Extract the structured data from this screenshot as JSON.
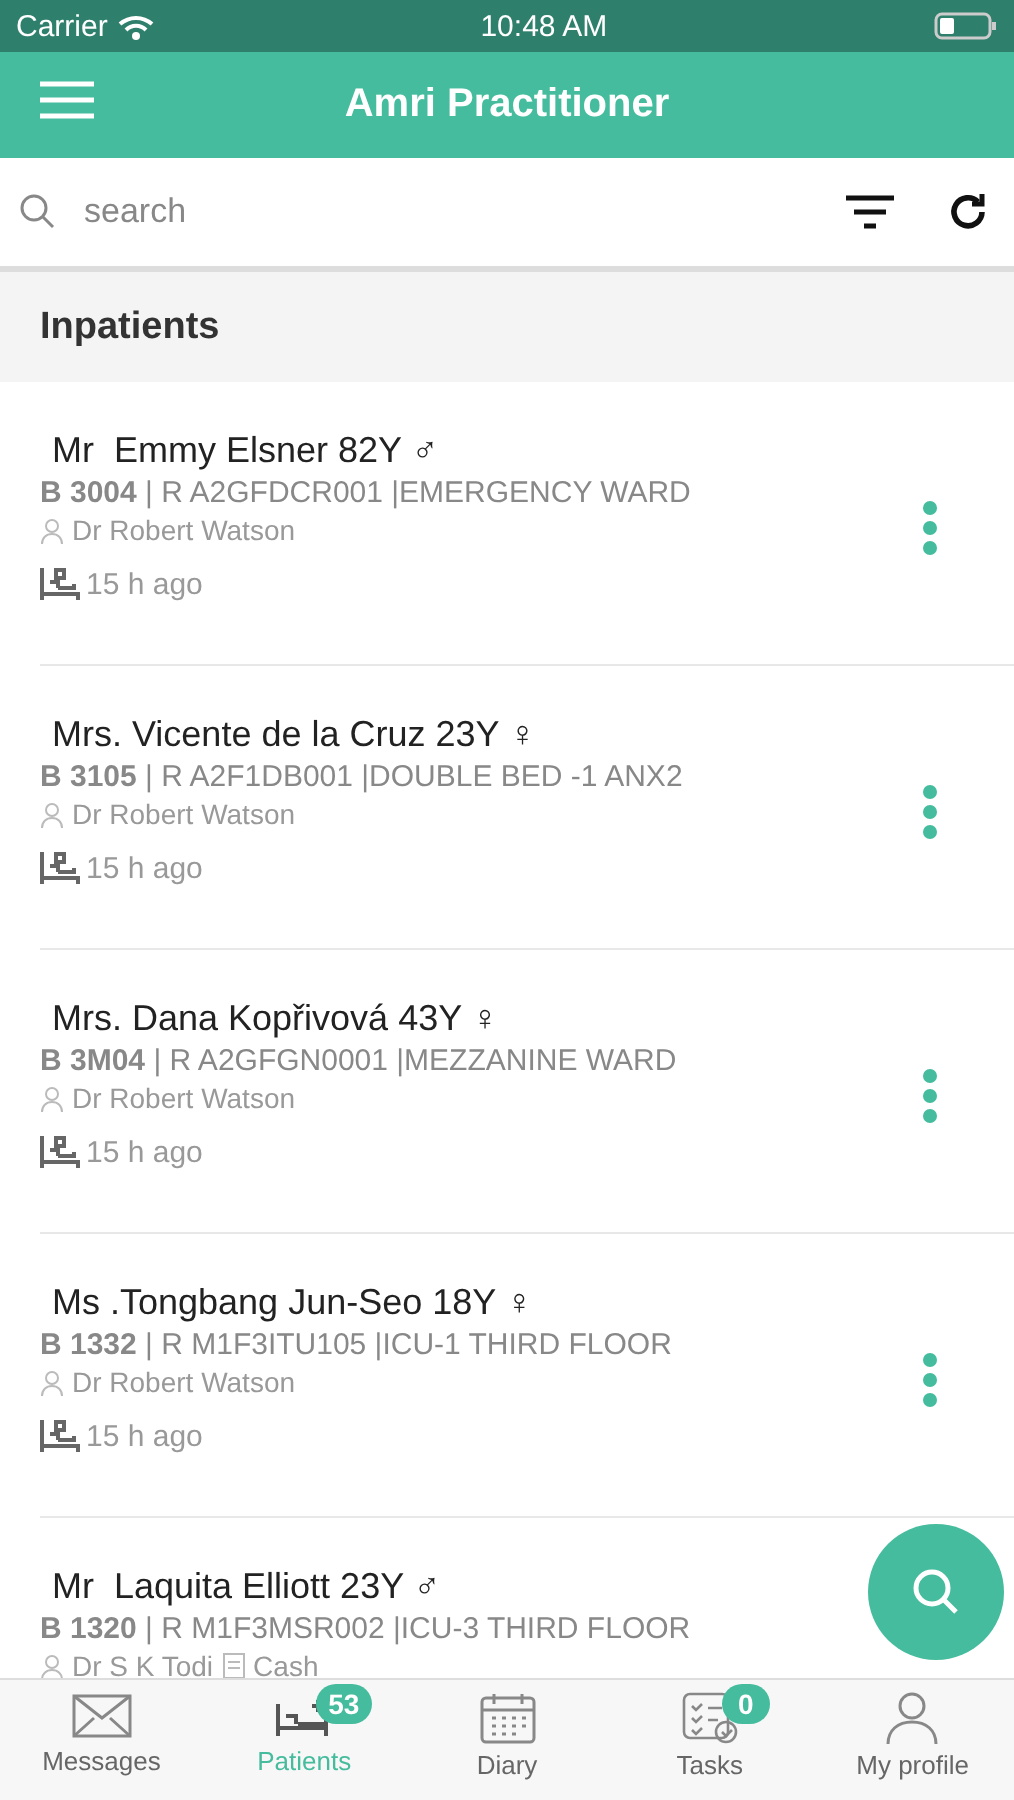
{
  "status_bar": {
    "carrier": "Carrier",
    "time": "10:48 AM"
  },
  "header": {
    "title": "Amri Practitioner"
  },
  "search": {
    "placeholder": "search"
  },
  "section": {
    "title": "Inpatients"
  },
  "patients": [
    {
      "name": "Mr  Emmy Elsner 82Y ♂",
      "bed": "B 3004",
      "room": " | R A2GFDCR001 |EMERGENCY WARD",
      "doctor": "Dr Robert Watson",
      "time": "15 h ago"
    },
    {
      "name": "Mrs. Vicente de la Cruz 23Y ♀",
      "bed": "B 3105",
      "room": " | R A2F1DB001 |DOUBLE BED -1 ANX2",
      "doctor": "Dr Robert Watson",
      "time": "15 h ago"
    },
    {
      "name": "Mrs. Dana Kopřivová 43Y ♀",
      "bed": "B 3M04",
      "room": " | R A2GFGN0001 |MEZZANINE WARD",
      "doctor": "Dr Robert Watson",
      "time": "15 h ago"
    },
    {
      "name": "Ms .Tongbang Jun-Seo 18Y ♀",
      "bed": "B 1332",
      "room": " | R M1F3ITU105 |ICU-1 THIRD FLOOR",
      "doctor": "Dr Robert Watson",
      "time": "15 h ago"
    },
    {
      "name": "Mr  Laquita Elliott 23Y ♂",
      "bed": "B 1320",
      "room": " | R M1F3MSR002 |ICU-3 THIRD FLOOR",
      "doctor": "Dr S K  Todi",
      "payment": "Cash"
    }
  ],
  "tabs": [
    {
      "kind": "messages",
      "label": "Messages",
      "selected": false
    },
    {
      "kind": "patients",
      "label": "Patients",
      "selected": true,
      "badge": "53"
    },
    {
      "kind": "diary",
      "label": "Diary",
      "selected": false
    },
    {
      "kind": "tasks",
      "label": "Tasks",
      "selected": false,
      "badge": "0"
    },
    {
      "kind": "profile",
      "label": "My profile",
      "selected": false
    }
  ]
}
